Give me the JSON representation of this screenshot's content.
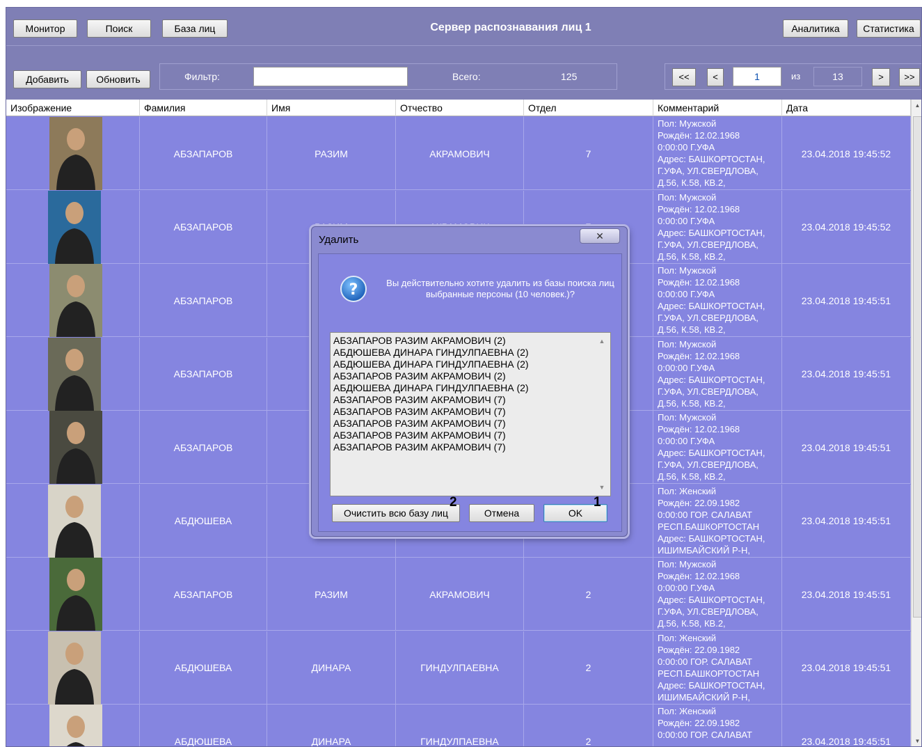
{
  "toolbar": {
    "monitor": "Монитор",
    "search": "Поиск",
    "face_db": "База лиц",
    "title": "Сервер распознавания лиц 1",
    "analytics": "Аналитика",
    "statistics": "Статистика"
  },
  "actions": {
    "add": "Добавить",
    "refresh": "Обновить",
    "filter_label": "Фильтр:",
    "filter_value": "",
    "total_label": "Всего:",
    "total_value": "125"
  },
  "pager": {
    "first": "<<",
    "prev": "<",
    "current": "1",
    "of_label": "из",
    "total_pages": "13",
    "next": ">",
    "last": ">>"
  },
  "table": {
    "headers": [
      "Изображение",
      "Фамилия",
      "Имя",
      "Отчество",
      "Отдел",
      "Комментарий",
      "Дата"
    ],
    "rows": [
      {
        "surname": "АБЗАПАРОВ",
        "name": "РАЗИМ",
        "patronymic": "АКРАМОВИЧ",
        "dept": "7",
        "comment": "Пол: Мужской\nРождён: 12.02.1968\n0:00:00 Г.УФА\nАдрес: БАШКОРТОСТАН,\nГ.УФА, УЛ.СВЕРДЛОВА,\nД.56, К.58, КВ.2,",
        "date": "23.04.2018 19:45:52"
      },
      {
        "surname": "АБЗАПАРОВ",
        "name": "РАЗИМ",
        "patronymic": "АКРАМОВИЧ",
        "dept": "7",
        "comment": "Пол: Мужской\nРождён: 12.02.1968\n0:00:00 Г.УФА\nАдрес: БАШКОРТОСТАН,\nГ.УФА, УЛ.СВЕРДЛОВА,\nД.56, К.58, КВ.2,",
        "date": "23.04.2018 19:45:52"
      },
      {
        "surname": "АБЗАПАРОВ",
        "name": "",
        "patronymic": "",
        "dept": "",
        "comment": "Пол: Мужской\nРождён: 12.02.1968\n0:00:00 Г.УФА\nАдрес: БАШКОРТОСТАН,\nГ.УФА, УЛ.СВЕРДЛОВА,\nД.56, К.58, КВ.2,",
        "date": "23.04.2018 19:45:51"
      },
      {
        "surname": "АБЗАПАРОВ",
        "name": "",
        "patronymic": "",
        "dept": "",
        "comment": "Пол: Мужской\nРождён: 12.02.1968\n0:00:00 Г.УФА\nАдрес: БАШКОРТОСТАН,\nГ.УФА, УЛ.СВЕРДЛОВА,\nД.56, К.58, КВ.2,",
        "date": "23.04.2018 19:45:51"
      },
      {
        "surname": "АБЗАПАРОВ",
        "name": "",
        "patronymic": "",
        "dept": "",
        "comment": "Пол: Мужской\nРождён: 12.02.1968\n0:00:00 Г.УФА\nАдрес: БАШКОРТОСТАН,\nГ.УФА, УЛ.СВЕРДЛОВА,\nД.56, К.58, КВ.2,",
        "date": "23.04.2018 19:45:51"
      },
      {
        "surname": "АБДЮШЕВА",
        "name": "",
        "patronymic": "",
        "dept": "",
        "comment": "Пол: Женский\nРождён: 22.09.1982\n0:00:00 ГОР. САЛАВАТ\nРЕСП.БАШКОРТОСТАН\nАдрес: БАШКОРТОСТАН,\nИШИМБАЙСКИЙ Р-Н,",
        "date": "23.04.2018 19:45:51"
      },
      {
        "surname": "АБЗАПАРОВ",
        "name": "РАЗИМ",
        "patronymic": "АКРАМОВИЧ",
        "dept": "2",
        "comment": "Пол: Мужской\nРождён: 12.02.1968\n0:00:00 Г.УФА\nАдрес: БАШКОРТОСТАН,\nГ.УФА, УЛ.СВЕРДЛОВА,\nД.56, К.58, КВ.2,",
        "date": "23.04.2018 19:45:51"
      },
      {
        "surname": "АБДЮШЕВА",
        "name": "ДИНАРА",
        "patronymic": "ГИНДУЛПАЕВНА",
        "dept": "2",
        "comment": "Пол: Женский\nРождён: 22.09.1982\n0:00:00 ГОР. САЛАВАТ\nРЕСП.БАШКОРТОСТАН\nАдрес: БАШКОРТОСТАН,\nИШИМБАЙСКИЙ Р-Н,",
        "date": "23.04.2018 19:45:51"
      },
      {
        "surname": "АБДЮШЕВА",
        "name": "ДИНАРА",
        "patronymic": "ГИНДУЛПАЕВНА",
        "dept": "2",
        "comment": "Пол: Женский\nРождён: 22.09.1982\n0:00:00 ГОР. САЛАВАТ",
        "date": "23.04.2018 19:45:51"
      }
    ]
  },
  "dialog": {
    "title": "Удалить",
    "message": "Вы действительно хотите удалить из базы поиска лиц выбранные персоны (10 человек.)?",
    "items": [
      "АБЗАПАРОВ РАЗИМ АКРАМОВИЧ (2)",
      "АБДЮШЕВА ДИНАРА ГИНДУЛПАЕВНА (2)",
      "АБДЮШЕВА ДИНАРА ГИНДУЛПАЕВНА (2)",
      "АБЗАПАРОВ РАЗИМ АКРАМОВИЧ (2)",
      "АБДЮШЕВА ДИНАРА ГИНДУЛПАЕВНА (2)",
      "АБЗАПАРОВ РАЗИМ АКРАМОВИЧ (7)",
      "АБЗАПАРОВ РАЗИМ АКРАМОВИЧ (7)",
      "АБЗАПАРОВ РАЗИМ АКРАМОВИЧ (7)",
      "АБЗАПАРОВ РАЗИМ АКРАМОВИЧ (7)",
      "АБЗАПАРОВ РАЗИМ АКРАМОВИЧ (7)"
    ],
    "clear_all": "Очистить всю базу лиц",
    "cancel": "Отмена",
    "ok": "OK",
    "marker_clear": "2",
    "marker_ok": "1"
  },
  "colors": {
    "app_bg": "#7f7fb5",
    "table_bg": "#8585e0",
    "dialog_bg": "#8a8ad0"
  }
}
